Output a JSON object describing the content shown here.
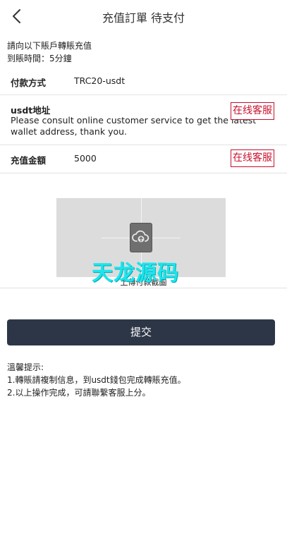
{
  "header": {
    "title": "充值訂單 待支付"
  },
  "intro": {
    "line1": "請向以下賬戶轉賬充值",
    "line2": "到賬時間：5分鐘"
  },
  "payment": {
    "label": "付款方式",
    "value": "TRC20-usdt"
  },
  "address": {
    "label": "usdt地址",
    "text": "Please consult online customer service to get the latest wallet address, thank you.",
    "cs_label": "在线客服"
  },
  "amount": {
    "label": "充值金額",
    "value": "5000",
    "cs_label": "在线客服"
  },
  "upload": {
    "label": "上傳付款截圖",
    "watermark": "天龙源码"
  },
  "submit_label": "提交",
  "tips": {
    "title": "溫馨提示:",
    "line1": "1.轉賬請複制信息，到usdt錢包完成轉賬充值。",
    "line2": "2.以上操作完成，可請聯繫客服上分。"
  },
  "colors": {
    "accent_red": "#c8102e",
    "button_dark": "#2d3646",
    "watermark_cyan": "#19e6ee"
  },
  "icons": [
    "chevron-left-icon",
    "cloud-upload-icon"
  ]
}
